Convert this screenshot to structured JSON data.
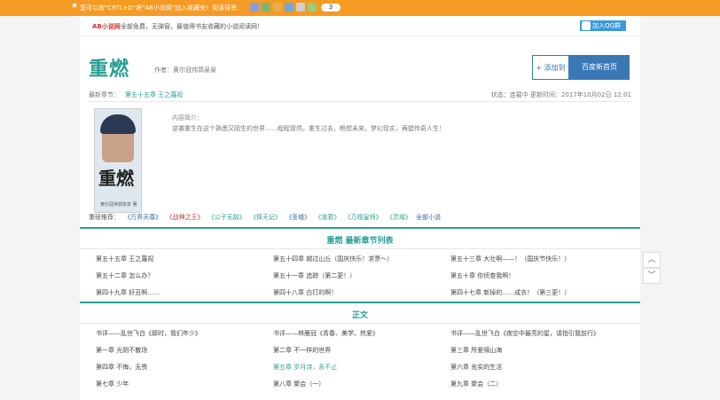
{
  "topbar": {
    "notice": "您可以按\"CRTL+D\"将\"AB小说网\"加入收藏夹！阅读背景：",
    "page_num": "3",
    "icon_colors": [
      "#8b9cd6",
      "#7fb56a",
      "#e3b04b",
      "#6fa8dc",
      "#cfcfcf",
      "#9dc97a"
    ]
  },
  "header": {
    "logo": "AB小说网",
    "slogan": "全部免费，无弹窗，最值得书友收藏的小说阅读网！",
    "qq_button": "加入QQ群"
  },
  "book": {
    "title": "重燃",
    "author": "作者：黄尔冠伟郭泉泉",
    "add_button": "+ 添加到",
    "home_button": "百度新首页",
    "latest_label": "最新章节：",
    "latest_chapter": "第五十五章 王之蔑视",
    "status": "状态：连载中 更新时间：2017年10月02日 12:01",
    "cover_title": "重燃",
    "cover_author": "黄尔冠伟郭泉泉 著",
    "intro_label": "内容简介：",
    "intro_text": "逆袭重生在这个熟悉又陌生的世界……程程冒然。重生过去，畅想未来。梦幻现实，再塑传奇人生！"
  },
  "recommend": {
    "label": "重磅推荐：",
    "items": [
      {
        "text": "《万界天尊》",
        "color": "#2c6aa6"
      },
      {
        "text": "《战神之王》",
        "color": "#c0392b"
      },
      {
        "text": "《公子无敌》",
        "color": "#2a9e94"
      },
      {
        "text": "《择天记》",
        "color": "#2a9e94"
      },
      {
        "text": "《圣墟》",
        "color": "#2c6aa6"
      },
      {
        "text": "《道君》",
        "color": "#2a9e94"
      },
      {
        "text": "《万相皇师》",
        "color": "#2a9e94"
      },
      {
        "text": "《灵域》",
        "color": "#2a9e94"
      },
      {
        "text": "全部小说",
        "color": "#2c6aa6"
      }
    ]
  },
  "latest_section": {
    "title": "重燃 最新章节列表",
    "rows": [
      [
        "第五十五章 王之蔑视",
        "第五十四章 越过山丘（国庆快乐！求票～）",
        "第五十三章 大壮啊——！（国庆节快乐！）"
      ],
      [
        "第五十二章 怎么办？",
        "第五十一章 追踪（第二更！）",
        "第五十章 你侦查我啊！"
      ],
      [
        "第四十九章 好丑啊……",
        "第四十八章 白打的啊！",
        "第四十七章 新掉的……成衣！（第三更！）"
      ]
    ]
  },
  "main_section": {
    "title": "正文",
    "rows": [
      [
        "书评——乱世飞白《那时，我们年少》",
        "书评——林雁冠《青春、美学、热爱》",
        "书评——乱世飞白《夜空中最亮的星，请指引我前行》"
      ],
      [
        "第一章 光阴不散场",
        "第二章 不一样的世界",
        "第三章 所爱隔山海"
      ],
      [
        "第四章 不悔，无畏",
        "第五章 岁月诗，永不止",
        "第六章 充实的生活"
      ],
      [
        "第七章 少年",
        "第八章 聚会（一）",
        "第九章 聚会（二）"
      ]
    ]
  },
  "side": {
    "up": "︿",
    "down": "﹀"
  }
}
